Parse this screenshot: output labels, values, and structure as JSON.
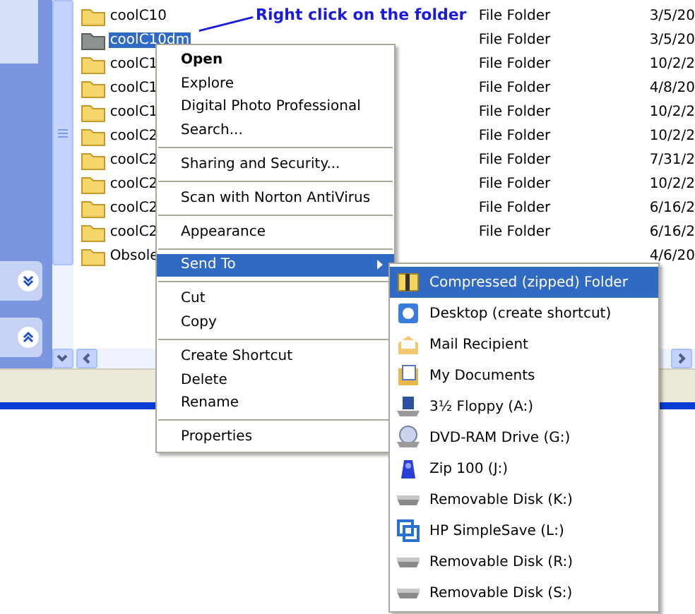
{
  "annotation": {
    "text": "Right click on the folder"
  },
  "files": [
    {
      "name": "coolC10",
      "type": "File Folder",
      "date": "3/5/20",
      "selected": false
    },
    {
      "name": "coolC10dm",
      "type": "File Folder",
      "date": "3/5/20",
      "selected": true
    },
    {
      "name": "coolC1",
      "type": "File Folder",
      "date": "10/2/2",
      "selected": false
    },
    {
      "name": "coolC1",
      "type": "File Folder",
      "date": "4/8/20",
      "selected": false
    },
    {
      "name": "coolC1",
      "type": "File Folder",
      "date": "10/2/2",
      "selected": false
    },
    {
      "name": "coolC2",
      "type": "File Folder",
      "date": "10/2/2",
      "selected": false
    },
    {
      "name": "coolC2",
      "type": "File Folder",
      "date": "7/31/2",
      "selected": false
    },
    {
      "name": "coolC2",
      "type": "File Folder",
      "date": "10/2/2",
      "selected": false
    },
    {
      "name": "coolC2",
      "type": "File Folder",
      "date": "6/16/2",
      "selected": false
    },
    {
      "name": "coolC2",
      "type": "File Folder",
      "date": "6/16/2",
      "selected": false
    },
    {
      "name": "Obsole",
      "date": "4/6/20",
      "selected": false
    }
  ],
  "context_menu": {
    "items": [
      {
        "kind": "item",
        "label": "Open",
        "default": true,
        "selected": false,
        "submenu": false
      },
      {
        "kind": "item",
        "label": "Explore",
        "default": false,
        "selected": false,
        "submenu": false
      },
      {
        "kind": "item",
        "label": "Digital Photo Professional",
        "default": false,
        "selected": false,
        "submenu": false
      },
      {
        "kind": "item",
        "label": "Search...",
        "default": false,
        "selected": false,
        "submenu": false
      },
      {
        "kind": "separator"
      },
      {
        "kind": "item",
        "label": "Sharing and Security...",
        "default": false,
        "selected": false,
        "submenu": false
      },
      {
        "kind": "separator"
      },
      {
        "kind": "item",
        "label": "Scan with Norton AntiVirus",
        "default": false,
        "selected": false,
        "submenu": false
      },
      {
        "kind": "separator"
      },
      {
        "kind": "item",
        "label": "Appearance",
        "default": false,
        "selected": false,
        "submenu": false
      },
      {
        "kind": "separator"
      },
      {
        "kind": "item",
        "label": "Send To",
        "default": false,
        "selected": true,
        "submenu": true
      },
      {
        "kind": "separator"
      },
      {
        "kind": "item",
        "label": "Cut",
        "default": false,
        "selected": false,
        "submenu": false
      },
      {
        "kind": "item",
        "label": "Copy",
        "default": false,
        "selected": false,
        "submenu": false
      },
      {
        "kind": "separator"
      },
      {
        "kind": "item",
        "label": "Create Shortcut",
        "default": false,
        "selected": false,
        "submenu": false
      },
      {
        "kind": "item",
        "label": "Delete",
        "default": false,
        "selected": false,
        "submenu": false
      },
      {
        "kind": "item",
        "label": "Rename",
        "default": false,
        "selected": false,
        "submenu": false
      },
      {
        "kind": "separator"
      },
      {
        "kind": "item",
        "label": "Properties",
        "default": false,
        "selected": false,
        "submenu": false
      }
    ]
  },
  "send_to_menu": {
    "items": [
      {
        "kind": "zip",
        "label": "Compressed (zipped) Folder",
        "selected": true
      },
      {
        "kind": "desktop",
        "label": "Desktop (create shortcut)",
        "selected": false
      },
      {
        "kind": "mail",
        "label": "Mail Recipient",
        "selected": false
      },
      {
        "kind": "documents",
        "label": "My Documents",
        "selected": false
      },
      {
        "kind": "floppy",
        "label": "3½ Floppy (A:)",
        "selected": false
      },
      {
        "kind": "dvd",
        "label": "DVD-RAM Drive (G:)",
        "selected": false
      },
      {
        "kind": "zipdrive",
        "label": "Zip 100  (J:)",
        "selected": false
      },
      {
        "kind": "removable",
        "label": "Removable Disk (K:)",
        "selected": false
      },
      {
        "kind": "backup",
        "label": "HP SimpleSave (L:)",
        "selected": false
      },
      {
        "kind": "removable",
        "label": "Removable Disk (R:)",
        "selected": false
      },
      {
        "kind": "removable",
        "label": "Removable Disk (S:)",
        "selected": false
      }
    ]
  }
}
